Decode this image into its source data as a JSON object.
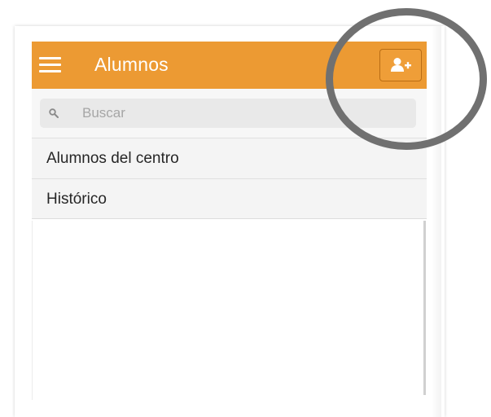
{
  "header": {
    "title": "Alumnos",
    "menu_icon": "hamburger-menu-icon",
    "add_button_icon": "add-user-icon",
    "accent_color": "#ec9a33"
  },
  "search": {
    "placeholder": "Buscar",
    "value": "",
    "icon": "search-icon"
  },
  "list": {
    "items": [
      {
        "label": "Alumnos del centro"
      },
      {
        "label": "Histórico"
      }
    ]
  },
  "annotation": {
    "type": "highlight-circle",
    "color": "#707070",
    "target": "add-user-button"
  }
}
